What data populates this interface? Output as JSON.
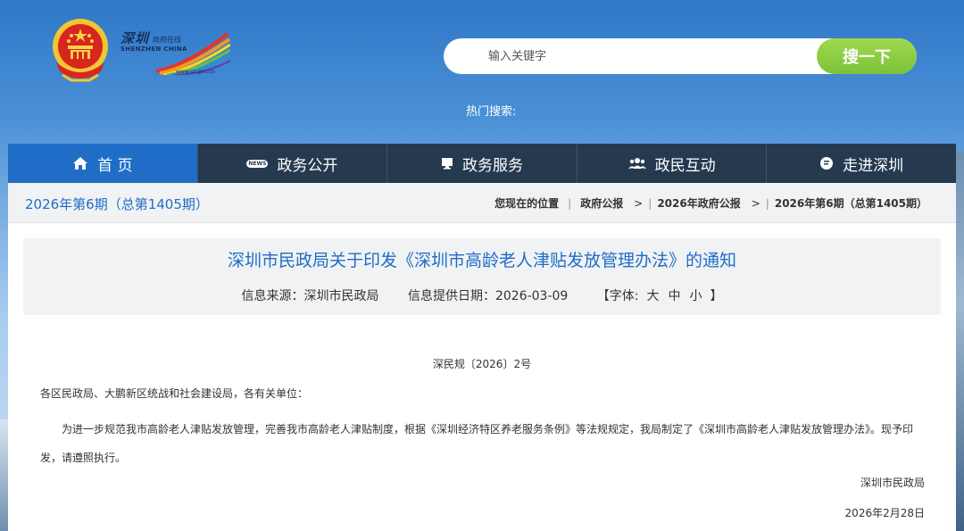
{
  "header": {
    "logo": {
      "cn": "深圳",
      "sub": "政府在线",
      "en": "SHENZHEN CHINA",
      "url": "www.sz.gov.cn"
    },
    "search": {
      "placeholder": "输入关键字",
      "button": "搜一下"
    },
    "hot_search_label": "热门搜索:"
  },
  "nav": {
    "items": [
      {
        "label": "首 页",
        "icon": "home-icon",
        "active": true
      },
      {
        "label": "政务公开",
        "icon": "news-icon",
        "badge": "NEWS"
      },
      {
        "label": "政务服务",
        "icon": "monitor-icon"
      },
      {
        "label": "政民互动",
        "icon": "people-icon"
      },
      {
        "label": "走进深圳",
        "icon": "chat-icon"
      }
    ]
  },
  "breadcrumb": {
    "issue": "2026年第6期（总第1405期）",
    "location_label": "您现在的位置",
    "items": [
      "政府公报",
      "2026年政府公报",
      "2026年第6期（总第1405期）"
    ]
  },
  "article": {
    "title": "深圳市民政局关于印发《深圳市高龄老人津贴发放管理办法》的通知",
    "source": "信息来源：深圳市民政局",
    "date": "信息提供日期：2026-03-09",
    "font_label": "【字体:",
    "font_sizes": [
      "大",
      "中",
      "小"
    ],
    "font_end": "】",
    "doc_number": "深民规〔2026〕2号",
    "recipients": "各区民政局、大鹏新区统战和社会建设局，各有关单位：",
    "body": "为进一步规范我市高龄老人津贴发放管理，完善我市高龄老人津贴制度，根据《深圳经济特区养老服务条例》等法规规定，我局制定了《深圳市高龄老人津贴发放管理办法》。现予印发，请遵照执行。",
    "signature_org": "深圳市民政局",
    "signature_date": "2026年2月28日"
  },
  "colors": {
    "accent": "#1f6dc7",
    "nav_bg": "#253a4f",
    "search_btn": "#8ccc44"
  }
}
